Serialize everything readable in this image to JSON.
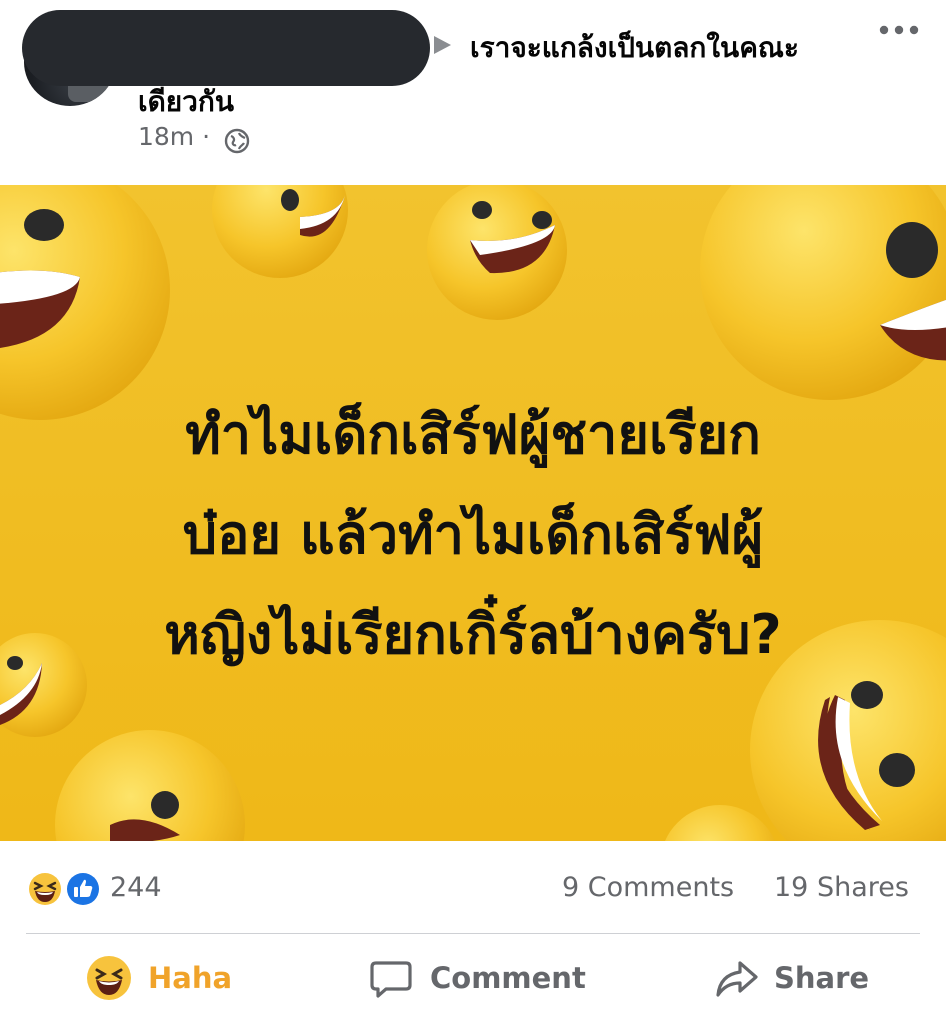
{
  "post": {
    "group_name": "เราจะแกล้งเป็นตลกในคณะ",
    "author_cont": "เดียวกัน",
    "time": "18m ·",
    "privacy_icon": "globe-icon",
    "more_icon": "more-dots-icon"
  },
  "image": {
    "caption_lines": [
      "ทำไมเด็กเสิร์ฟผู้ชายเรียก",
      "บ๋อย แล้วทำไมเด็กเสิร์ฟผู้",
      "หญิงไม่เรียกเกิ๋ร์ลบ้างครับ?"
    ],
    "background_color": "#f0bd22"
  },
  "stats": {
    "reaction_count": "244",
    "comments": "9 Comments",
    "shares": "19 Shares",
    "reaction_icons": [
      "haha-icon",
      "like-icon"
    ]
  },
  "actions": {
    "haha_label": "Haha",
    "comment_label": "Comment",
    "share_label": "Share",
    "haha_color": "#f0a32a",
    "muted_color": "#65676b"
  }
}
